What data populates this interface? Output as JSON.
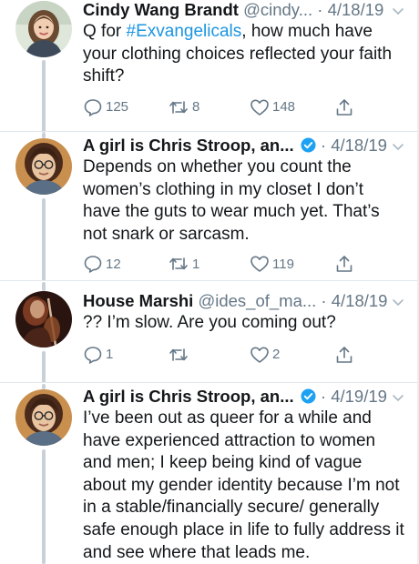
{
  "tweets": [
    {
      "name": "Cindy Wang Brandt",
      "handle": "@cindy...",
      "dot": " · ",
      "date": "4/18/19",
      "verified": false,
      "text_before": "Q for ",
      "hashtag": "#Exvangelicals",
      "text_after": ", how much have your clothing choices reflected your faith shift?",
      "replies": "125",
      "retweets": "8",
      "likes": "148"
    },
    {
      "name": "A girl is Chris Stroop, an...",
      "handle": "",
      "dot": " · ",
      "date": "4/18/19",
      "verified": true,
      "text": "Depends on whether you count the women’s clothing in my closet I don’t have the guts to wear much yet. That’s not snark or sarcasm.",
      "replies": "12",
      "retweets": "1",
      "likes": "119"
    },
    {
      "name": "House Marshi",
      "handle": "@ides_of_ma...",
      "dot": " · ",
      "date": "4/18/19",
      "verified": false,
      "text": "?? I’m slow. Are you coming out?",
      "replies": "1",
      "retweets": "",
      "likes": "2"
    },
    {
      "name": "A girl is Chris Stroop, an...",
      "handle": "",
      "dot": " · ",
      "date": "4/19/19",
      "verified": true,
      "text": "I’ve been out as queer for a while and have experienced attraction to women and men; I keep being kind of vague about my gender identity because I’m not in a stable/financially secure/ generally safe enough place in life to fully address it and see where that leads me."
    }
  ],
  "icons": {
    "reply": "reply-icon",
    "retweet": "retweet-icon",
    "like": "heart-icon",
    "share": "share-icon",
    "verified": "verified-badge-icon",
    "more": "chevron-down-icon"
  },
  "colors": {
    "link": "#1b95e0",
    "muted": "#657786",
    "verified": "#1da1f2",
    "thread_line": "#c8d0d8",
    "divider": "#e1e8ed"
  }
}
